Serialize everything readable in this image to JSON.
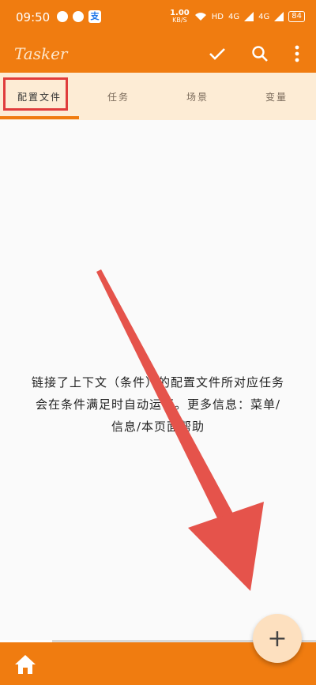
{
  "status_bar": {
    "time": "09:50",
    "net_speed_value": "1.00",
    "net_speed_unit": "KB/S",
    "hd_label": "HD",
    "signal1": "4G",
    "signal2": "4G",
    "battery": "84",
    "app_badge": "支"
  },
  "toolbar": {
    "title": "Tasker",
    "check_icon": "check-icon",
    "search_icon": "search-icon",
    "more_icon": "more-vert-icon"
  },
  "tabs": [
    {
      "label": "配置文件",
      "active": true
    },
    {
      "label": "任务",
      "active": false
    },
    {
      "label": "场景",
      "active": false
    },
    {
      "label": "变量",
      "active": false
    }
  ],
  "content": {
    "line1": "链接了上下文（条件）的配置文件所对应任务",
    "line2": "会在条件满足时自动运行。更多信息：菜单/",
    "line3": "信息/本页面帮助"
  },
  "fab": {
    "label": "+"
  },
  "colors": {
    "accent": "#f07c10",
    "tab_bg": "#fdecd5",
    "annotation": "#e03c3c"
  }
}
